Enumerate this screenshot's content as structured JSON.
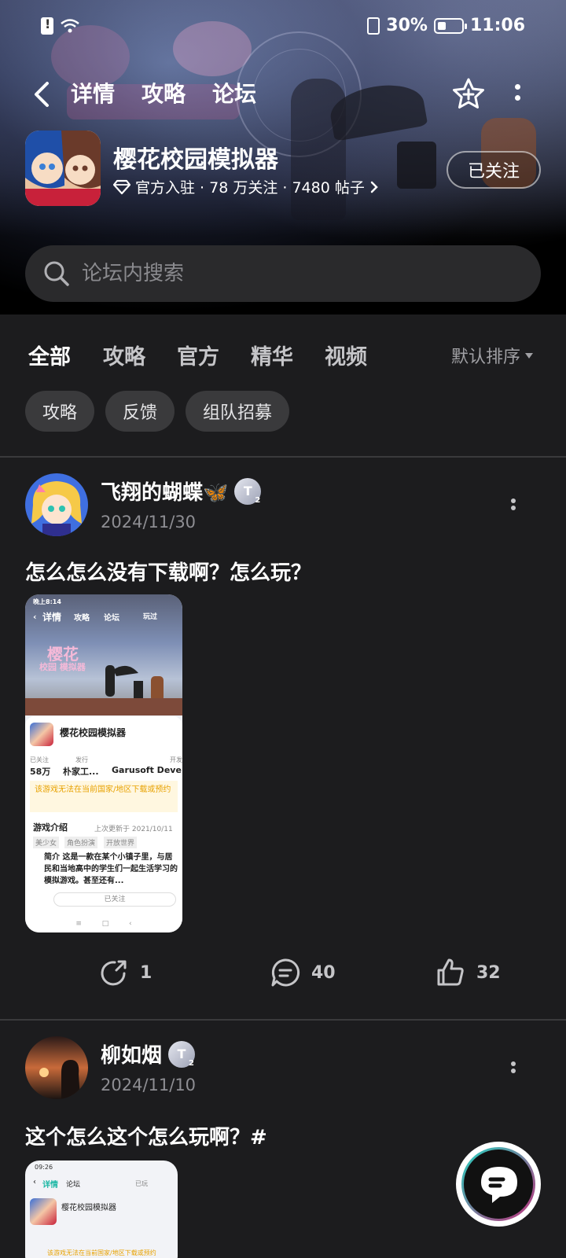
{
  "status_bar": {
    "battery": "30%",
    "time": "11:06"
  },
  "nav": {
    "tabs": [
      "详情",
      "攻略",
      "论坛"
    ],
    "active_tab": "论坛"
  },
  "game": {
    "title": "樱花校园模拟器",
    "meta": "官方入驻 · 78 万关注 · 7480 帖子",
    "follow_label": "已关注"
  },
  "search": {
    "placeholder": "论坛内搜索"
  },
  "category_tabs": [
    "全部",
    "攻略",
    "官方",
    "精华",
    "视频"
  ],
  "sort_label": "默认排序",
  "chips": [
    "攻略",
    "反馈",
    "组队招募"
  ],
  "accent_color": "#1fb8a6",
  "posts": [
    {
      "author": "飞翔的蝴蝶🦋",
      "date": "2024/11/30",
      "text": "怎么怎么没有下载啊？怎么玩？",
      "shares": "1",
      "comments": "40",
      "likes": "32",
      "screenshot": {
        "status_time": "晚上8:14",
        "nav_tabs": [
          "详情",
          "攻略",
          "论坛"
        ],
        "played_label": "玩过",
        "logo_line1": "樱花",
        "logo_line2": "校园 模拟器",
        "game_title": "樱花校园模拟器",
        "stat1_label": "已关注",
        "stat1_value": "58万",
        "stat2_label": "发行",
        "stat2_value": "朴家工...",
        "stat3_label": "开发",
        "stat3_value": "Garusoft Deve",
        "warning": "该游戏无法在当前国家/地区下载或预约",
        "intro_title": "游戏介绍",
        "intro_updated": "上次更新于 2021/10/11",
        "tags": [
          "美少女",
          "角色扮演",
          "开放世界"
        ],
        "intro_text": "简介 这是一款在某个小镇子里，与居民和当地高中的学生们一起生活学习的模拟游戏。甚至还有...",
        "followed_button": "已关注"
      }
    },
    {
      "author": "柳如烟",
      "date": "2024/11/10",
      "text": "这个怎么这个怎么玩啊？#",
      "screenshot": {
        "status_time": "09:26",
        "nav_tabs": [
          "详情",
          "论坛"
        ],
        "played_label": "已玩",
        "game_title": "樱花校园模拟器",
        "warning": "该游戏无法在当前国家/地区下载或预约"
      }
    }
  ]
}
